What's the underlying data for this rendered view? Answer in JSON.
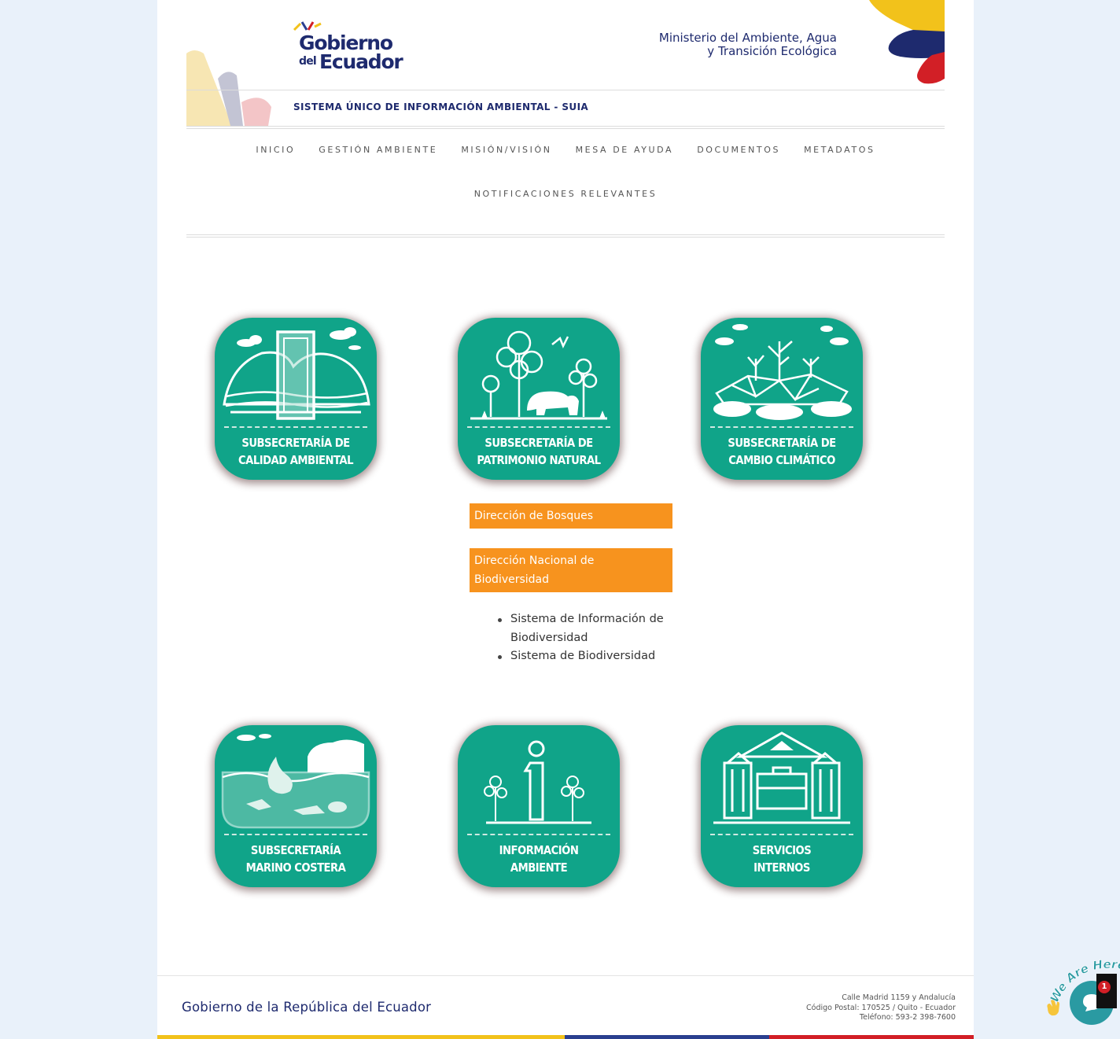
{
  "header": {
    "logo_line1": "Gobierno",
    "logo_line2a": "del",
    "logo_line2b": "Ecuador",
    "ministry_line1": "Ministerio del Ambiente, Agua",
    "ministry_line2": "y Transición Ecológica",
    "system_title": "SISTEMA ÚNICO DE INFORMACIÓN AMBIENTAL - SUIA"
  },
  "nav": {
    "row1": [
      "INICIO",
      "GESTIÓN AMBIENTE",
      "MISIÓN/VISIÓN",
      "MESA DE AYUDA",
      "DOCUMENTOS",
      "METADATOS"
    ],
    "row2": [
      "NOTIFICACIONES RELEVANTES"
    ]
  },
  "tiles": [
    {
      "line1": "SUBSECRETARÍA DE",
      "line2": "CALIDAD AMBIENTAL"
    },
    {
      "line1": "SUBSECRETARÍA DE",
      "line2": "PATRIMONIO NATURAL"
    },
    {
      "line1": "SUBSECRETARÍA DE",
      "line2": "CAMBIO CLIMÁTICO"
    },
    {
      "line1": "SUBSECRETARÍA",
      "line2": "MARINO COSTERA"
    },
    {
      "line1": "INFORMACIÓN",
      "line2": "AMBIENTE"
    },
    {
      "line1": "SERVICIOS",
      "line2": "INTERNOS"
    }
  ],
  "patrimonio_links": {
    "bosques": "Dirección de Bosques",
    "biodiversidad_line1": "Dirección Nacional de",
    "biodiversidad_line2": "Biodiversidad",
    "subitems": [
      "Sistema de Información de Biodiversidad",
      "Sistema de Biodiversidad"
    ]
  },
  "footer": {
    "title": "Gobierno de la República del Ecuador",
    "address_line1": "Calle Madrid 1159 y Andalucía",
    "address_line2": "Código Postal: 170525 / Quito - Ecuador",
    "address_line3": "Teléfono: 593-2 398-7600"
  },
  "chat": {
    "label": "We Are Here!",
    "badge_count": "1"
  },
  "colors": {
    "tile_green": "#10a489",
    "link_orange": "#f7931e",
    "navy": "#1e2a6e",
    "flag_yellow": "#f2c21b",
    "flag_blue": "#2a3f8f",
    "flag_red": "#d21f26",
    "chat_teal": "#2a9aa2"
  }
}
